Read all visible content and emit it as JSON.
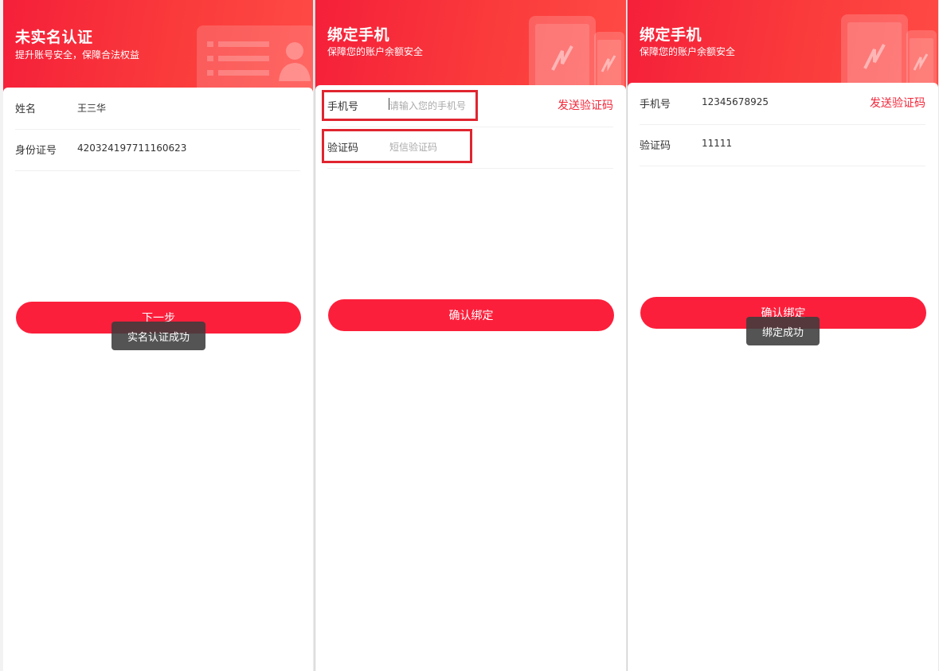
{
  "colors": {
    "accent": "#fc1f3b",
    "header_red": "#f51f3a",
    "highlight_box": "#e0252f",
    "link_red": "#f2273a"
  },
  "screen1": {
    "title": "未实名认证",
    "subtitle": "提升账号安全，保障合法权益",
    "fields": [
      {
        "label": "姓名",
        "value": "王三华"
      },
      {
        "label": "身份证号",
        "value": "420324197711160623"
      }
    ],
    "next_button": "下一步",
    "toast": "实名认证成功",
    "header_icon": "id-card-person-icon"
  },
  "screen2": {
    "title": "绑定手机",
    "subtitle": "保障您的账户余额安全",
    "phone_label": "手机号",
    "phone_placeholder": "请输入您的手机号",
    "send_code": "发送验证码",
    "code_label": "验证码",
    "code_placeholder": "短信验证码",
    "confirm_button": "确认绑定",
    "header_icon": "phones-icon"
  },
  "screen3": {
    "title": "绑定手机",
    "subtitle": "保障您的账户余额安全",
    "phone_label": "手机号",
    "phone_value": "12345678925",
    "send_code": "发送验证码",
    "code_label": "验证码",
    "code_value": "11111",
    "confirm_button": "确认绑定",
    "toast": "绑定成功",
    "header_icon": "phones-icon"
  }
}
